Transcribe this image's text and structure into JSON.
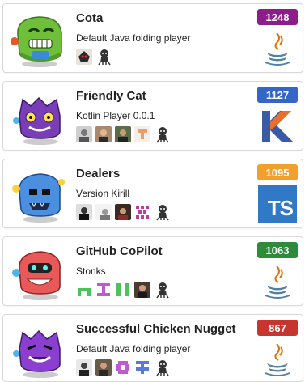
{
  "players": [
    {
      "name": "Cota",
      "description": "Default Java folding player",
      "score": "1248",
      "score_color": "#8e1d8c",
      "language_icon": "java-icon",
      "members": [
        "member-avatar-1",
        "github-icon"
      ]
    },
    {
      "name": "Friendly Cat",
      "description": "Kotlin Player 0.0.1",
      "score": "1127",
      "score_color": "#3466c8",
      "language_icon": "kotlin-icon",
      "members": [
        "member-avatar-1",
        "member-avatar-2",
        "member-avatar-3",
        "member-avatar-4",
        "github-icon"
      ]
    },
    {
      "name": "Dealers",
      "description": "Version Kirill",
      "score": "1095",
      "score_color": "#f2a02a",
      "language_icon": "typescript-icon",
      "language_text": "TS",
      "members": [
        "member-avatar-1",
        "member-avatar-2",
        "member-avatar-3",
        "member-avatar-4",
        "github-icon"
      ]
    },
    {
      "name": "GitHub CoPilot",
      "description": "Stonks",
      "score": "1063",
      "score_color": "#2e8b3a",
      "language_icon": "java-icon",
      "members": [
        "member-avatar-1",
        "member-avatar-2",
        "member-avatar-3",
        "member-avatar-4",
        "github-icon"
      ]
    },
    {
      "name": "Successful Chicken Nugget",
      "description": "Default Java folding player",
      "score": "867",
      "score_color": "#c8352e",
      "language_icon": "java-icon",
      "members": [
        "member-avatar-1",
        "member-avatar-2",
        "member-avatar-3",
        "member-avatar-4",
        "github-icon"
      ]
    }
  ]
}
